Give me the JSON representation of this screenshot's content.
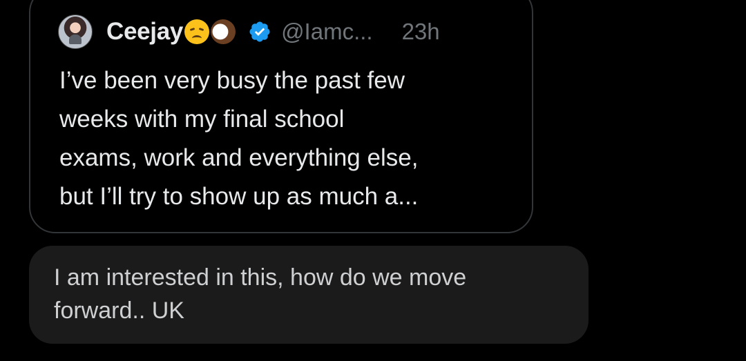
{
  "quoted_post": {
    "display_name": "Ceejay",
    "emoji_1": "disappointed-face",
    "emoji_2": "coconut",
    "verified_icon": "verified-badge-icon",
    "handle": "@Iamc...",
    "time": "23h",
    "text": "I’ve been very busy the past few\nweeks with my final school\nexams, work and everything else,\nbut I’ll try to show up as much a..."
  },
  "message": {
    "text": "I am interested in this, how do we move\nforward.. UK"
  },
  "colors": {
    "background": "#000000",
    "card_border": "#333639",
    "primary_text": "#e7e9ea",
    "secondary_text": "#71767b",
    "bubble": "#1b1b1b",
    "verified": "#1d9bf0"
  }
}
